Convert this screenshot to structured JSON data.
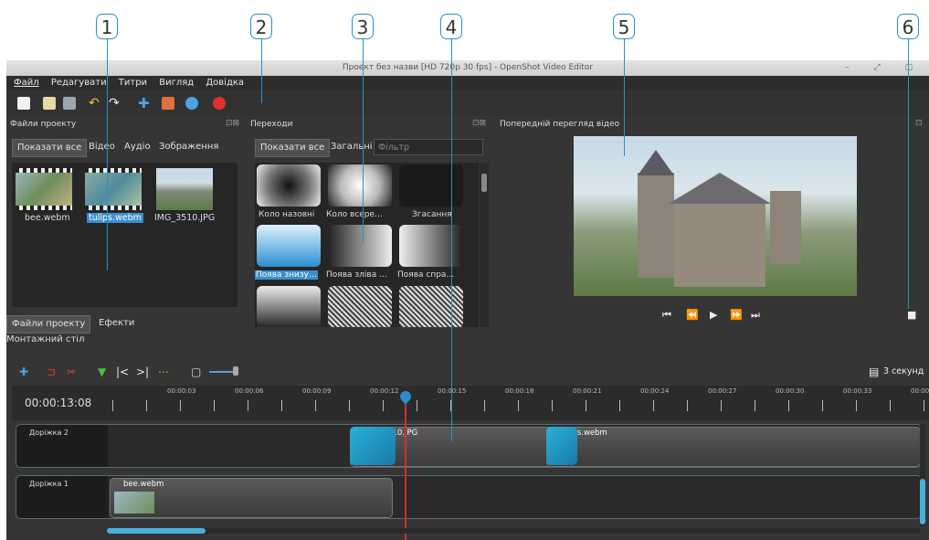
{
  "callouts": [
    "1",
    "2",
    "3",
    "4",
    "5",
    "6"
  ],
  "window": {
    "title": "Проект без назви [HD 720p 30 fps] - OpenShot Video Editor"
  },
  "menu": [
    "Файл",
    "Редагувати",
    "Титри",
    "Вигляд",
    "Довідка"
  ],
  "project_files": {
    "header": "Файли проекту",
    "tabs": [
      "Показати все",
      "Відео",
      "Аудіо",
      "Зображення"
    ],
    "files": [
      "bee.webm",
      "tulips.webm",
      "IMG_3510.JPG"
    ],
    "bottom_tabs": [
      "Файли проекту",
      "Ефекти"
    ]
  },
  "transitions": {
    "header": "Переходи",
    "tabs": [
      "Показати все",
      "Загальні"
    ],
    "filter_placeholder": "Фільтр",
    "items": [
      "Коло назовні",
      "Коло всере…",
      "Згасання",
      "Поява знизу…",
      "Поява зліва …",
      "Поява спра…"
    ]
  },
  "preview": {
    "header": "Попередній перегляд відео"
  },
  "timeline": {
    "header": "Монтажний стіл",
    "current_time": "00:00:13:08",
    "zoom_label": "3 секунд",
    "ticks": [
      "00:00:03",
      "00:00:06",
      "00:00:09",
      "00:00:12",
      "00:00:15",
      "00:00:18",
      "00:00:21",
      "00:00:24",
      "00:00:27",
      "00:00:30",
      "00:00:33",
      "00:00:3"
    ],
    "tracks": [
      {
        "name": "Доріжка 2",
        "clips": [
          "IMG_3510.JPG",
          "tulips.webm"
        ]
      },
      {
        "name": "Доріжка 1",
        "clips": [
          "bee.webm"
        ]
      }
    ]
  },
  "colors": {
    "accent": "#2a8fc9",
    "selection": "#3a8fd0",
    "playhead": "#d03030"
  }
}
